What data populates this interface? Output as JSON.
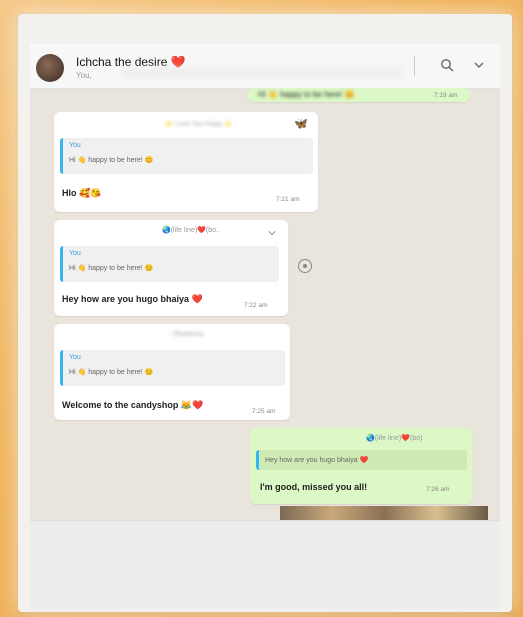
{
  "header": {
    "contact_name": "Ichcha the desire",
    "heart": "❤️",
    "subtitle": "You,"
  },
  "top_partial": {
    "text": "Hi 👋 happy to be here! 😊",
    "time": "7:19 am"
  },
  "messages": [
    {
      "sender_label": "✨ Love You Papa ✨",
      "quote_name": "You",
      "quote_text": "Hi 👋 happy to be here! 😊",
      "text": "Hlo 🥰😘",
      "time": "7:21 am"
    },
    {
      "sender_label": "🌏(life line)❤️(bo..",
      "quote_name": "You",
      "quote_text": "Hi 👋 happy to be here! 😊",
      "text": "Hey how are you hugo bhaiya ❤️",
      "time": "7:22 am"
    },
    {
      "sender_label": "~Ekaterina",
      "quote_name": "You",
      "quote_text": "Hi 👋 happy to be here! 😊",
      "text": "Welcome to the candyshop 😹❤️",
      "time": "7:25 am"
    },
    {
      "sender_label": "🌏(life line)❤️(bo)",
      "quote_name": "",
      "quote_text": "Hey how are you hugo bhaiya ❤️",
      "text": "I'm good, missed you all!",
      "time": "7:26 am"
    }
  ],
  "colors": {
    "outgoing": "#dcf8c6",
    "incoming": "#ffffff",
    "quote_accent": "#34b7f1"
  }
}
